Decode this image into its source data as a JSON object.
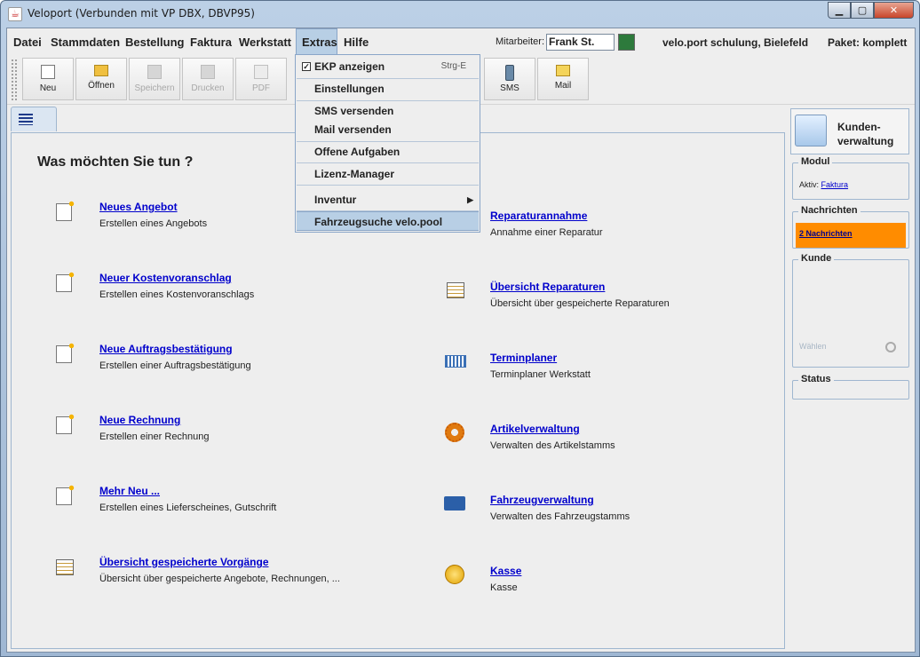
{
  "window": {
    "title": "Veloport (Verbunden mit VP DBX, DBVP95)"
  },
  "menubar": {
    "items": [
      "Datei",
      "Stammdaten",
      "Bestellung",
      "Faktura",
      "Werkstatt",
      "Extras",
      "Hilfe"
    ],
    "active": "Extras",
    "mitarbeiter_label": "Mitarbeiter:",
    "mitarbeiter_value": "Frank St.",
    "company": "velo.port schulung, Bielefeld",
    "paket": "Paket: komplett"
  },
  "toolbar": {
    "buttons": [
      {
        "label": "Neu",
        "enabled": true,
        "icon": "new-document-icon"
      },
      {
        "label": "Öffnen",
        "enabled": true,
        "icon": "folder-icon"
      },
      {
        "label": "Speichern",
        "enabled": false,
        "icon": "save-icon"
      },
      {
        "label": "Drucken",
        "enabled": false,
        "icon": "print-icon"
      },
      {
        "label": "PDF",
        "enabled": false,
        "icon": "pdf-icon"
      },
      {
        "label": "SMS",
        "enabled": true,
        "icon": "phone-icon"
      },
      {
        "label": "Mail",
        "enabled": true,
        "icon": "mail-icon"
      }
    ]
  },
  "extras_menu": {
    "items": [
      {
        "label": "EKP anzeigen",
        "checked": true,
        "accelerator": "Strg-E"
      },
      {
        "label": "Einstellungen"
      },
      {
        "label": "SMS versenden"
      },
      {
        "label": "Mail versenden"
      },
      {
        "label": "Offene Aufgaben"
      },
      {
        "label": "Lizenz-Manager"
      },
      {
        "label": "Inventur",
        "submenu": true
      },
      {
        "label": "Fahrzeugsuche velo.pool",
        "highlighted": true
      }
    ]
  },
  "main": {
    "heading": "Was möchten Sie tun ?",
    "left": [
      {
        "link": "Neues Angebot",
        "desc": "Erstellen eines Angebots",
        "icon": "new-document-icon"
      },
      {
        "link": "Neuer Kostenvoranschlag",
        "desc": "Erstellen eines Kostenvoranschlags",
        "icon": "new-document-icon"
      },
      {
        "link": "Neue Auftragsbestätigung",
        "desc": "Erstellen einer Auftragsbestätigung",
        "icon": "new-document-icon"
      },
      {
        "link": "Neue Rechnung",
        "desc": "Erstellen einer Rechnung",
        "icon": "new-document-icon"
      },
      {
        "link": "Mehr Neu ...",
        "desc": "Erstellen eines Lieferscheines, Gutschrift",
        "icon": "new-document-icon"
      },
      {
        "link": "Übersicht gespeicherte Vorgänge",
        "desc": "Übersicht über gespeicherte Angebote, Rechnungen, ...",
        "icon": "list-icon"
      }
    ],
    "right": [
      {
        "link": "Reparaturannahme",
        "desc": "Annahme einer Reparatur",
        "icon": ""
      },
      {
        "link": "Übersicht Reparaturen",
        "desc": "Übersicht über gespeicherte Reparaturen",
        "icon": "list-icon"
      },
      {
        "link": "Terminplaner",
        "desc": "Terminplaner Werkstatt",
        "icon": "calendar-icon"
      },
      {
        "link": "Artikelverwaltung",
        "desc": "Verwalten des Artikelstamms",
        "icon": "gear-icon"
      },
      {
        "link": "Fahrzeugverwaltung",
        "desc": "Verwalten des Fahrzeugstamms",
        "icon": "bicycle-icon"
      },
      {
        "link": "Kasse",
        "desc": "Kasse",
        "icon": "coins-icon"
      }
    ]
  },
  "sidebar": {
    "kunden_label_1": "Kunden-",
    "kunden_label_2": "verwaltung",
    "modul_title": "Modul",
    "modul_aktiv_label": "Aktiv:",
    "modul_aktiv_value": "Faktura",
    "nachrichten_title": "Nachrichten",
    "nachrichten_link": "2 Nachrichten",
    "nachrichten_color": "#ff8c00",
    "kunde_title": "Kunde",
    "kunde_waehlen": "Wählen",
    "status_title": "Status"
  }
}
